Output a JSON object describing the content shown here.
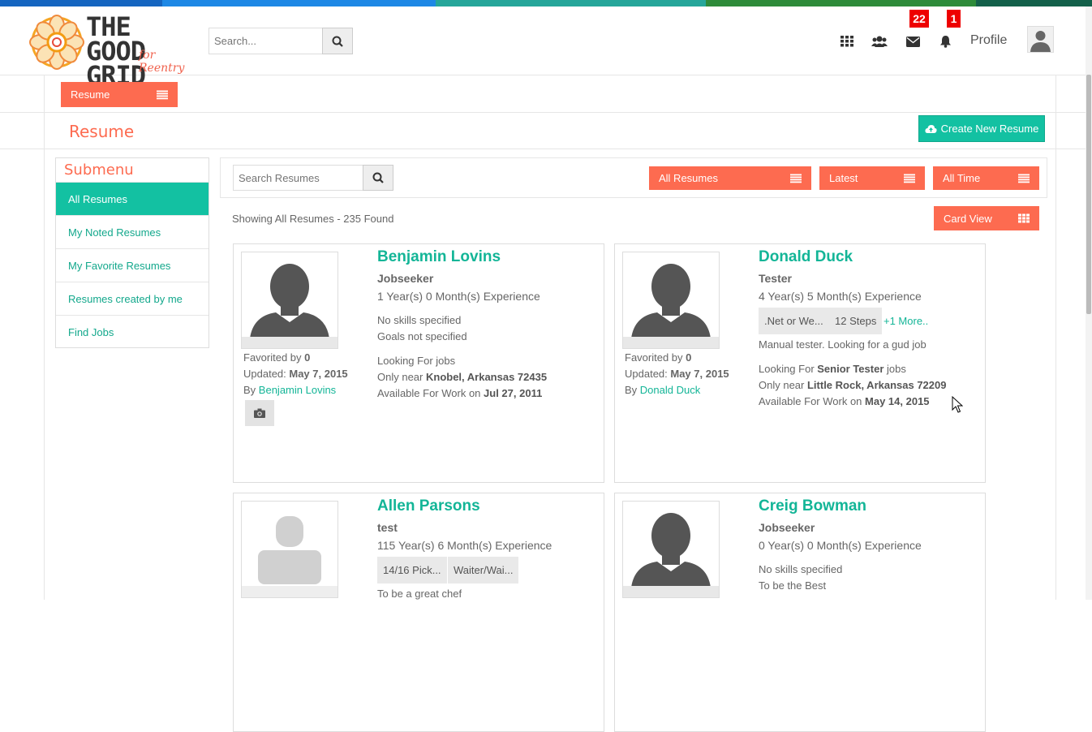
{
  "colors": {
    "accent_orange": "#fd6b50",
    "accent_teal": "#13c1a2",
    "badge_red": "#ee0000",
    "stripe": [
      "#1565c0",
      "#1e88e5",
      "#26a69a",
      "#00897b",
      "#2e7d32",
      "#1b5e20"
    ]
  },
  "header": {
    "logo_alt": "The Good Grid for Reentry",
    "logo_line1": "THE GOOD",
    "logo_line2": "GRID",
    "logo_script": "for Reentry",
    "search_placeholder": "Search...",
    "icons": [
      "grid-icon",
      "users-icon",
      "mail-icon",
      "bell-icon"
    ],
    "mail_badge": "22",
    "bell_badge": "1",
    "profile_label": "Profile"
  },
  "section_dropdown": {
    "label": "Resume"
  },
  "page": {
    "title": "Resume",
    "create_button": "Create New Resume"
  },
  "submenu": {
    "title": "Submenu",
    "items": [
      {
        "label": "All Resumes",
        "active": true
      },
      {
        "label": "My Noted Resumes",
        "active": false
      },
      {
        "label": "My Favorite Resumes",
        "active": false
      },
      {
        "label": "Resumes created by me",
        "active": false
      },
      {
        "label": "Find Jobs",
        "active": false
      }
    ]
  },
  "filters": {
    "search_placeholder": "Search Resumes",
    "type_filter": "All Resumes",
    "sort_filter": "Latest",
    "time_filter": "All Time",
    "view_toggle": "Card View",
    "result_text": "Showing All Resumes - 235 Found"
  },
  "cards": [
    {
      "name": "Benjamin Lovins",
      "role": "Jobseeker",
      "experience": "1 Year(s) 0 Month(s) Experience",
      "skills_text": "No skills specified",
      "goals_text": "Goals not specified",
      "looking_prefix": "Looking For jobs",
      "near_prefix": "Only near ",
      "near_location": "Knobel, Arkansas 72435",
      "available_prefix": "Available For Work on ",
      "available_date": "Jul 27, 2011",
      "favorited_prefix": "Favorited by ",
      "favorited_count": "0",
      "updated_prefix": "Updated: ",
      "updated_date": "May 7, 2015",
      "by_prefix": "By",
      "by_name": "Benjamin Lovins"
    },
    {
      "name": "Donald Duck",
      "role": "Tester",
      "experience": "4 Year(s) 5 Month(s) Experience",
      "tags": [
        ".Net or We...",
        "12 Steps"
      ],
      "more_link": "+1 More..",
      "summary": "Manual tester. Looking for a gud job",
      "looking_prefix": "Looking For ",
      "looking_title": "Senior Tester",
      "looking_suffix": " jobs",
      "near_prefix": "Only near ",
      "near_location": "Little Rock, Arkansas 72209",
      "available_prefix": "Available For Work on ",
      "available_date": "May 14, 2015",
      "favorited_prefix": "Favorited by ",
      "favorited_count": "0",
      "updated_prefix": "Updated: ",
      "updated_date": "May 7, 2015",
      "by_prefix": "By",
      "by_name": "Donald Duck"
    },
    {
      "name": "Allen Parsons",
      "role": "test",
      "experience": "115 Year(s) 6 Month(s) Experience",
      "tags": [
        "14/16 Pick...",
        "Waiter/Wai..."
      ],
      "summary": "To be a great chef"
    },
    {
      "name": "Creig Bowman",
      "role": "Jobseeker",
      "experience": "0 Year(s) 0 Month(s) Experience",
      "skills_text": "No skills specified",
      "goals_text": "To be the Best"
    }
  ]
}
